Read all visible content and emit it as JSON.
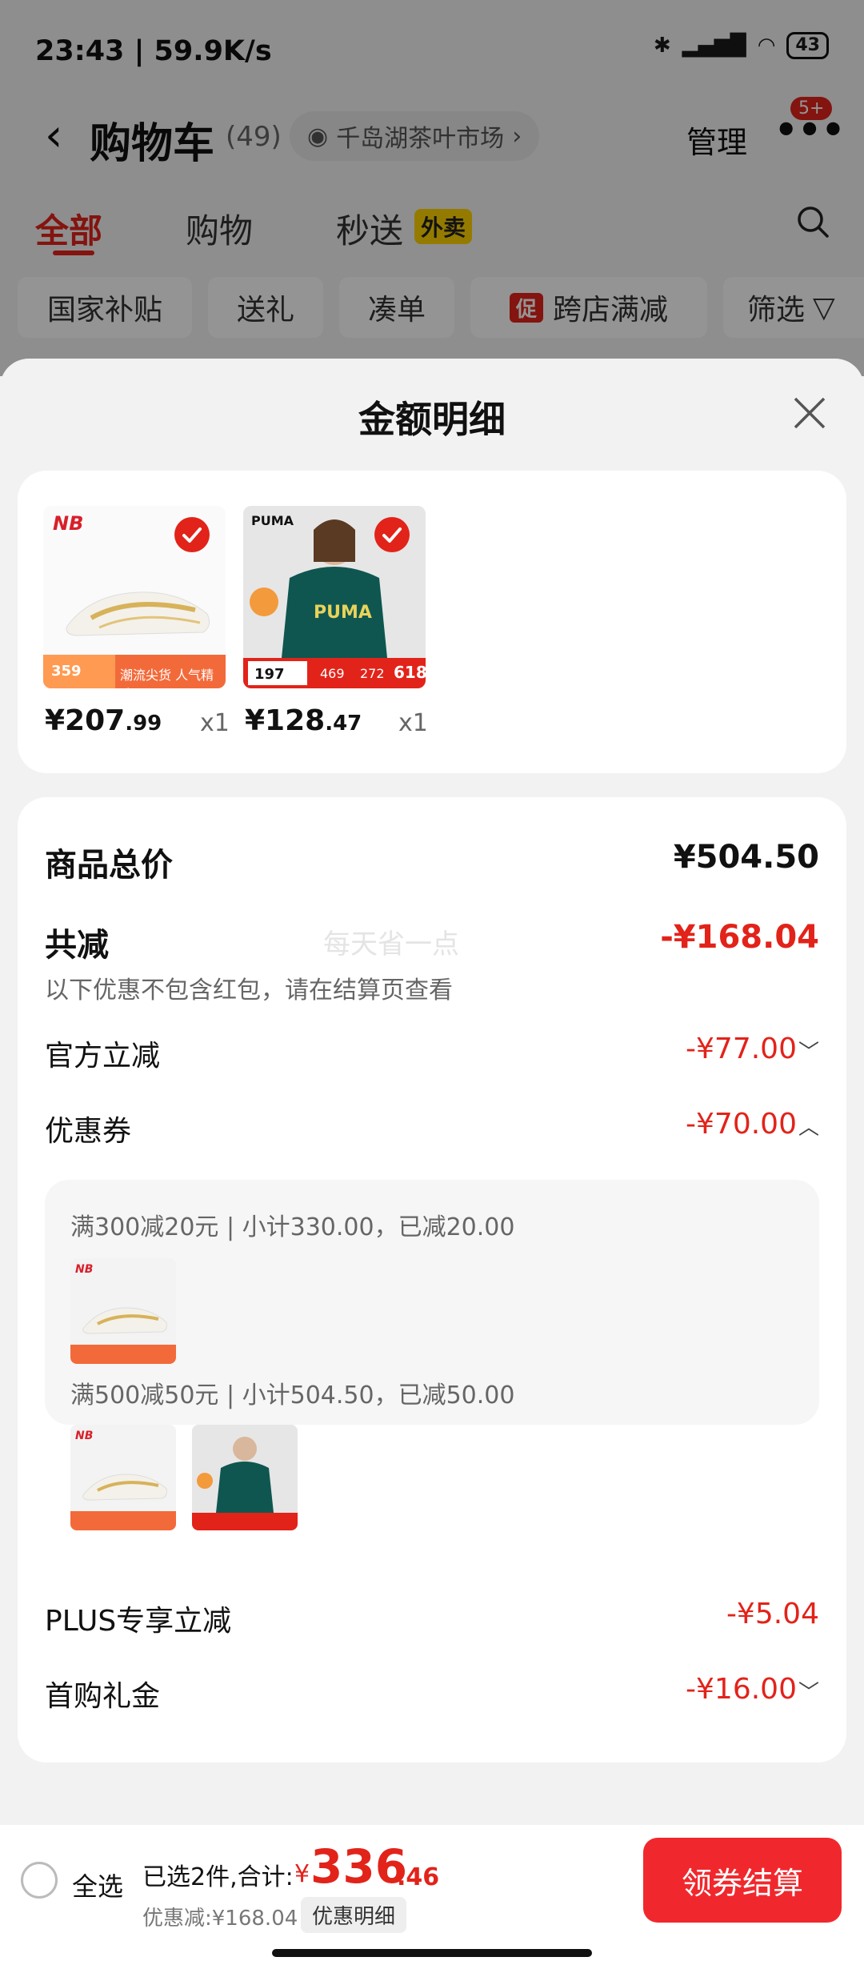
{
  "status_bar": {
    "time_speed": "23:43 | 59.9K/s",
    "battery": "43"
  },
  "header": {
    "back_glyph": "‹",
    "title": "购物车",
    "count": "(49)",
    "store": "千岛湖茶叶市场",
    "manage": "管理",
    "more_glyph": "•••",
    "badge": "5+"
  },
  "tabs": [
    {
      "label": "全部"
    },
    {
      "label": "购物"
    },
    {
      "label": "秒送"
    }
  ],
  "tab_badge": "外卖",
  "filters": [
    {
      "label": "国家补贴"
    },
    {
      "label": "送礼"
    },
    {
      "label": "凑单"
    },
    {
      "label": "跨店满减",
      "tag": "促"
    },
    {
      "label": "筛选"
    }
  ],
  "sheet": {
    "title": "金额明细",
    "products": [
      {
        "price_int": "¥207",
        "price_dec": ".99",
        "qty": "x1",
        "thumb_price": "359",
        "thumb_tag": "潮流尖货 人气精选",
        "brand": "NB"
      },
      {
        "price_int": "¥128",
        "price_dec": ".47",
        "qty": "x1",
        "thumb_price": "197",
        "thumb_mid": "469",
        "thumb_mid2": "272",
        "thumb_tag": "618",
        "brand": "PUMA"
      }
    ],
    "total_label": "商品总价",
    "total_value": "¥504.50",
    "reduce_label": "共减",
    "reduce_value": "-¥168.04",
    "watermark": "每天省一点",
    "reduce_note": "以下优惠不包含红包，请在结算页查看",
    "official_label": "官方立减",
    "official_value": "-¥77.00",
    "coupon_label": "优惠券",
    "coupon_value": "-¥70.00",
    "coupon_lines": [
      "满300减20元 | 小计330.00，已减20.00",
      "满500减50元 | 小计504.50，已减50.00"
    ],
    "plus_label": "PLUS专享立减",
    "plus_value": "-¥5.04",
    "firstbuy_label": "首购礼金",
    "firstbuy_value": "-¥16.00"
  },
  "bottom": {
    "select_all": "全选",
    "selected_text": "已选2件,合计:",
    "yen": "¥",
    "total_int": "336",
    "total_dec": ".46",
    "discount_text": "优惠减:¥168.04",
    "detail_chip": "优惠明细",
    "checkout": "领券结算"
  },
  "colors": {
    "accent": "#e2231a",
    "checkout_bg": "#f0282d"
  }
}
